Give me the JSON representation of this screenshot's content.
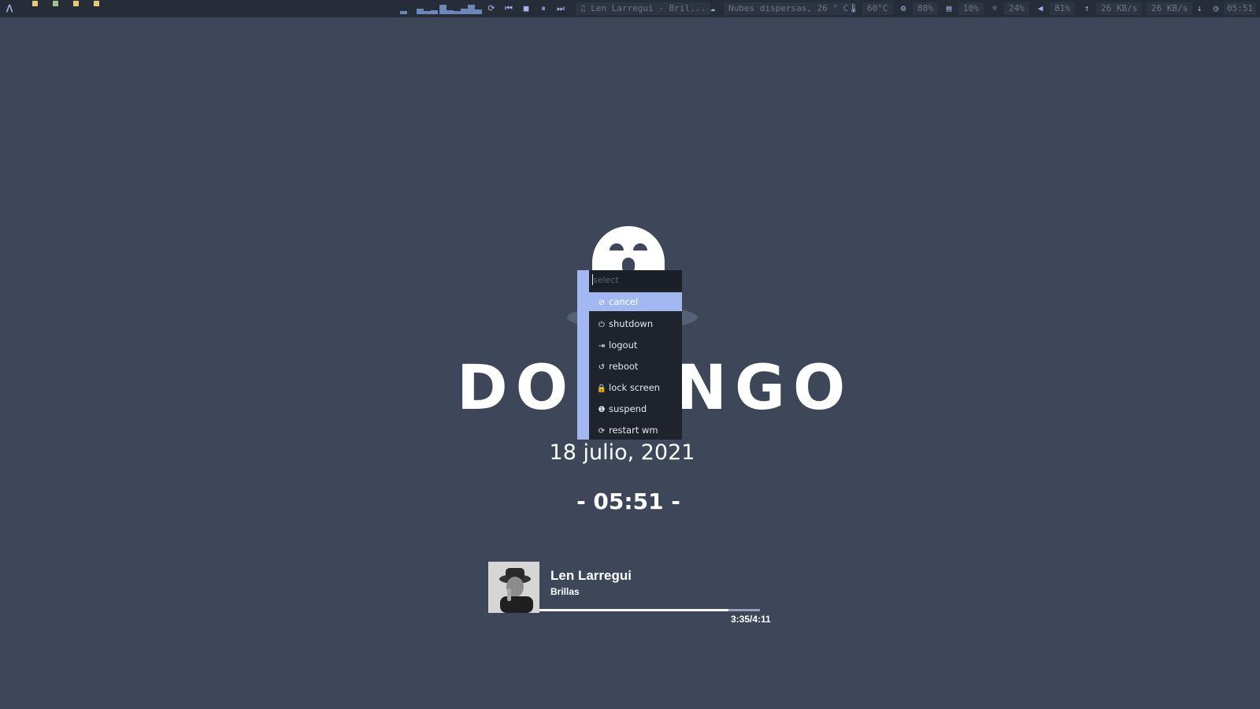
{
  "topbar": {
    "launcher_icon": "arch-icon",
    "launcher_glyph": "ᐱ",
    "workspaces": [
      {
        "name": "workspace-1",
        "color": "#e8c97a"
      },
      {
        "name": "workspace-2",
        "color": "#a5c38e"
      },
      {
        "name": "workspace-3",
        "color": "#e8c97a"
      },
      {
        "name": "workspace-4",
        "color": "#e8c97a"
      }
    ],
    "media_controls": {
      "repeat_icon": "⟳",
      "prev_icon": "⏮",
      "stop_icon": "■",
      "pause_icon": "⏸",
      "next_icon": "⏭"
    },
    "now_playing": "♫ Len Larregui - Bril...",
    "weather": {
      "icon": "☁",
      "text": "Nubes dispersas, 26 ° C"
    },
    "temperature": {
      "icon": "🌡",
      "text": "60°C"
    },
    "cpu": {
      "icon": "⚙",
      "text": "88%"
    },
    "memory": {
      "icon": "▤",
      "text": "10%"
    },
    "brightness": {
      "icon": "☼",
      "text": "24%"
    },
    "volume": {
      "icon": "◀",
      "text": "81%"
    },
    "upload": {
      "icon": "↑",
      "text": "26 KB/s"
    },
    "download": {
      "icon": "↓",
      "text": "26 KB/s"
    },
    "clock": {
      "icon": "◷",
      "text": "05:51"
    },
    "accent": "#9fb4e8"
  },
  "desktop": {
    "day_name": "DOMINGO",
    "date": "18 julio, 2021",
    "time": "- 05:51 -"
  },
  "music": {
    "artist": "Len Larregui",
    "song": "Brillas",
    "time": "3:35/4:11",
    "progress": 0.857
  },
  "powermenu": {
    "search_placeholder": "select",
    "items": [
      {
        "label": "cancel",
        "icon": "⊘",
        "icon_name": "cancel-icon",
        "selected": true
      },
      {
        "label": "shutdown",
        "icon": "⏻",
        "icon_name": "power-icon",
        "selected": false
      },
      {
        "label": "logout",
        "icon": "⇥",
        "icon_name": "logout-icon",
        "selected": false
      },
      {
        "label": "reboot",
        "icon": "↺",
        "icon_name": "reboot-icon",
        "selected": false
      },
      {
        "label": "lock screen",
        "icon": "🔒",
        "icon_name": "lock-icon",
        "selected": false
      },
      {
        "label": "suspend",
        "icon": "❶",
        "icon_name": "suspend-icon",
        "selected": false
      },
      {
        "label": "restart wm",
        "icon": "⟳",
        "icon_name": "restart-icon",
        "selected": false
      }
    ],
    "accent": "#a3b8f0"
  }
}
